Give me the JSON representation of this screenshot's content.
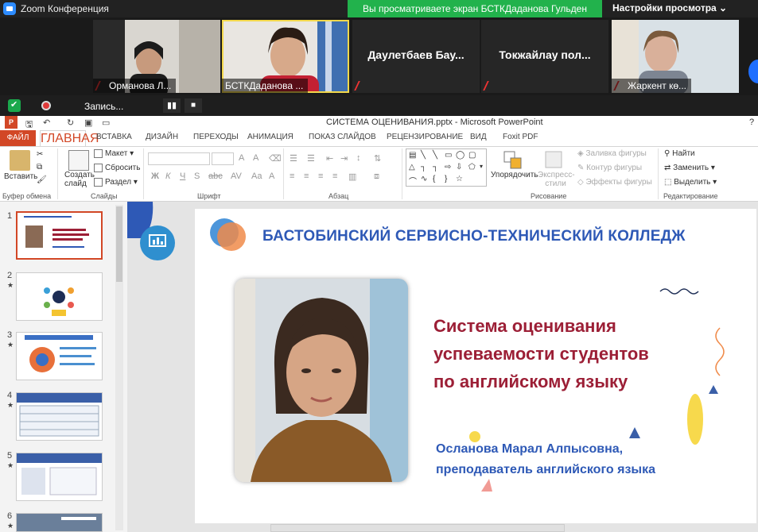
{
  "zoom": {
    "window_title": "Zoom Конференция",
    "share_banner": "Вы просматриваете экран БСТКДаданова Гульден",
    "view_options": "Настройки просмотра",
    "participants": [
      {
        "name": "Орманова Л..."
      },
      {
        "name": "БСТКДаданова ..."
      },
      {
        "name": "Даулетбаев Бау..."
      },
      {
        "name": "Токжайлау пол..."
      },
      {
        "name": "Жаркент кө..."
      }
    ],
    "recording_label": "Запись...",
    "pause_icon": "▮▮",
    "stop_icon": "■"
  },
  "ppt": {
    "app_logo": "P",
    "window_title": "СИСТЕМА ОЦЕНИВАНИЯ.pptx - Microsoft PowerPoint",
    "help": "?",
    "tabs": [
      "ФАЙЛ",
      "ГЛАВНАЯ",
      "ВСТАВКА",
      "ДИЗАЙН",
      "ПЕРЕХОДЫ",
      "АНИМАЦИЯ",
      "ПОКАЗ СЛАЙДОВ",
      "РЕЦЕНЗИРОВАНИЕ",
      "ВИД",
      "Foxit PDF"
    ],
    "ribbon": {
      "paste": "Вставить",
      "clipboard_group": "Буфер обмена",
      "new_slide": "Создать слайд",
      "layout": "Макет",
      "reset": "Сбросить",
      "section": "Раздел",
      "slides_group": "Слайды",
      "font_group": "Шрифт",
      "paragraph_group": "Абзац",
      "arrange": "Упорядочить",
      "quick_styles": "Экспресс-стили",
      "shape_fill": "Заливка фигуры",
      "shape_outline": "Контур фигуры",
      "shape_effects": "Эффекты фигуры",
      "drawing_group": "Рисование",
      "find": "Найти",
      "replace": "Заменить",
      "select": "Выделить",
      "editing_group": "Редактирование"
    },
    "thumbnails": [
      "1",
      "2",
      "3",
      "4",
      "5",
      "6"
    ],
    "star": "★",
    "slide": {
      "college": "БАСТОБИНСКИЙ СЕРВИСНО-ТЕХНИЧЕСКИЙ КОЛЛЕДЖ",
      "heading_lines": [
        "Система оценивания",
        "успеваемости студентов",
        "по английскому языку"
      ],
      "author": "Осланова Марал Алпысовна,",
      "role": "преподаватель английского языка"
    }
  }
}
